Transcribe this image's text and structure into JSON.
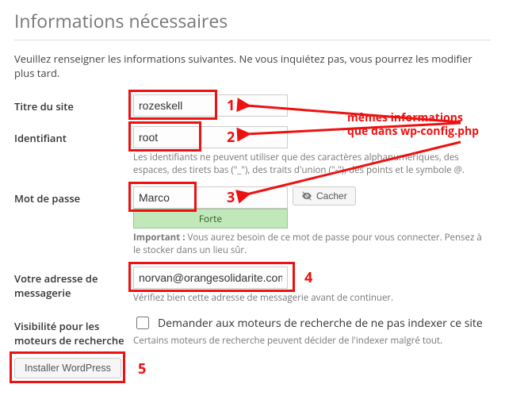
{
  "heading": "Informations nécessaires",
  "intro": "Veuillez renseigner les informations suivantes. Ne vous inquiétez pas, vous pourrez les modifier plus tard.",
  "fields": {
    "site_title": {
      "label": "Titre du site",
      "value": "rozeskell"
    },
    "username": {
      "label": "Identifiant",
      "value": "root",
      "hint": "Les identifiants ne peuvent utiliser que des caractères alphanumériques, des espaces, des tirets bas (\"_\"), des traits d'union (\"-\"), des points et le symbole @."
    },
    "password": {
      "label": "Mot de passe",
      "value": "Marco",
      "strength": "Forte",
      "hide_button": "Cacher",
      "hint_strong": "Important :",
      "hint": " Vous aurez besoin de ce mot de passe pour vous connecter. Pensez à le stocker dans un lieu sûr."
    },
    "email": {
      "label": "Votre adresse de messagerie",
      "value": "norvan@orangesolidarite.com",
      "hint": "Vérifiez bien cette adresse de messagerie avant de continuer."
    },
    "privacy": {
      "label": "Visibilité pour les moteurs de recherche",
      "checkbox": "Demander aux moteurs de recherche de ne pas indexer ce site",
      "hint": "Certains moteurs de recherche peuvent décider de l'indexer malgré tout."
    }
  },
  "install_button": "Installer WordPress",
  "annotations": {
    "note_line1": "mêmes informations",
    "note_line2": "que dans wp-config.php",
    "n1": "1",
    "n2": "2",
    "n3": "3",
    "n4": "4",
    "n5": "5"
  }
}
